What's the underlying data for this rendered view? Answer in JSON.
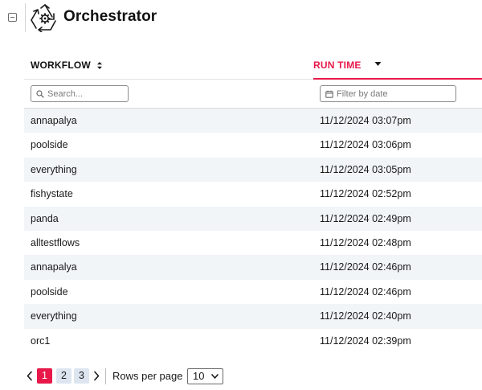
{
  "header": {
    "title": "Orchestrator"
  },
  "table": {
    "columns": {
      "workflow": "WORKFLOW",
      "run_time": "RUN TIME"
    },
    "filters": {
      "workflow_placeholder": "Search...",
      "run_time_placeholder": "Filter by date"
    },
    "rows": [
      {
        "workflow": "annapalya",
        "run_time": "11/12/2024 03:07pm"
      },
      {
        "workflow": "poolside",
        "run_time": "11/12/2024 03:06pm"
      },
      {
        "workflow": "everything",
        "run_time": "11/12/2024 03:05pm"
      },
      {
        "workflow": "fishystate",
        "run_time": "11/12/2024 02:52pm"
      },
      {
        "workflow": "panda",
        "run_time": "11/12/2024 02:49pm"
      },
      {
        "workflow": "alltestflows",
        "run_time": "11/12/2024 02:48pm"
      },
      {
        "workflow": "annapalya",
        "run_time": "11/12/2024 02:46pm"
      },
      {
        "workflow": "poolside",
        "run_time": "11/12/2024 02:46pm"
      },
      {
        "workflow": "everything",
        "run_time": "11/12/2024 02:40pm"
      },
      {
        "workflow": "orc1",
        "run_time": "11/12/2024 02:39pm"
      }
    ]
  },
  "pagination": {
    "pages": [
      "1",
      "2",
      "3"
    ],
    "current_page": "1",
    "rows_per_page_label": "Rows per page",
    "rows_per_page_value": "10"
  },
  "colors": {
    "accent": "#e8194a",
    "row_alt": "#f1f5f8",
    "page_inactive": "#dde6f0"
  },
  "icons": {
    "collapse": "minus-square-icon",
    "logo": "recycle-gear-icon",
    "workflow_sort": "sort-updown-icon",
    "run_time_sort": "caret-down-icon",
    "search": "search-icon",
    "calendar": "calendar-icon",
    "prev": "chevron-left-icon",
    "next": "chevron-right-icon"
  }
}
